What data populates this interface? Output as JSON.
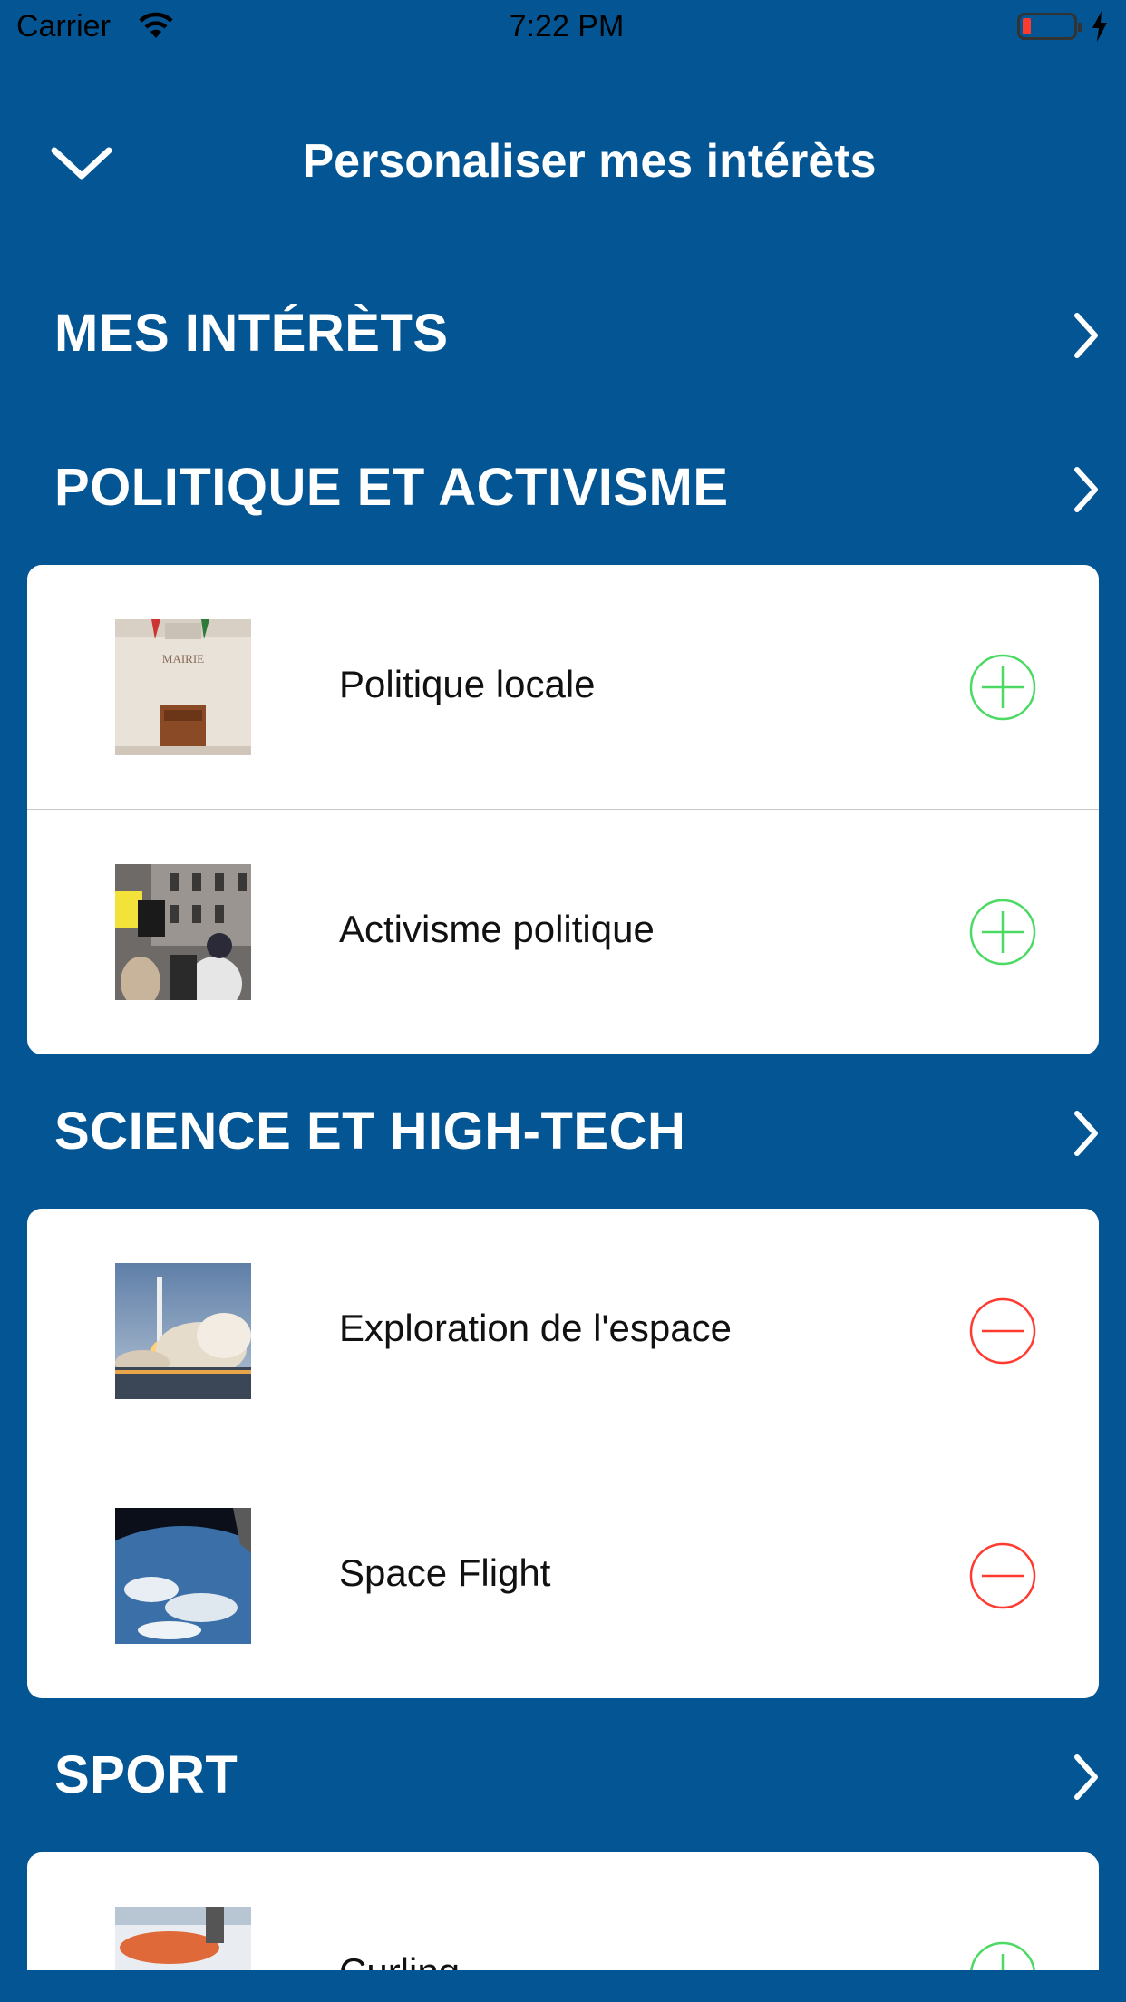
{
  "status_bar": {
    "carrier": "Carrier",
    "time": "7:22 PM"
  },
  "header": {
    "title": "Personaliser mes intérèts"
  },
  "sections": [
    {
      "title": "MES INTÉRÈTS",
      "items": []
    },
    {
      "title": "POLITIQUE ET ACTIVISME",
      "items": [
        {
          "label": "Politique locale",
          "action": "add"
        },
        {
          "label": "Activisme politique",
          "action": "add"
        }
      ]
    },
    {
      "title": "SCIENCE ET HIGH-TECH",
      "items": [
        {
          "label": "Exploration de l'espace",
          "action": "remove"
        },
        {
          "label": "Space Flight",
          "action": "remove"
        }
      ]
    },
    {
      "title": "SPORT",
      "items": [
        {
          "label": "Curling",
          "action": "add"
        }
      ]
    }
  ],
  "colors": {
    "background": "#035594",
    "add": "#4cd964",
    "remove": "#ff3b30"
  }
}
